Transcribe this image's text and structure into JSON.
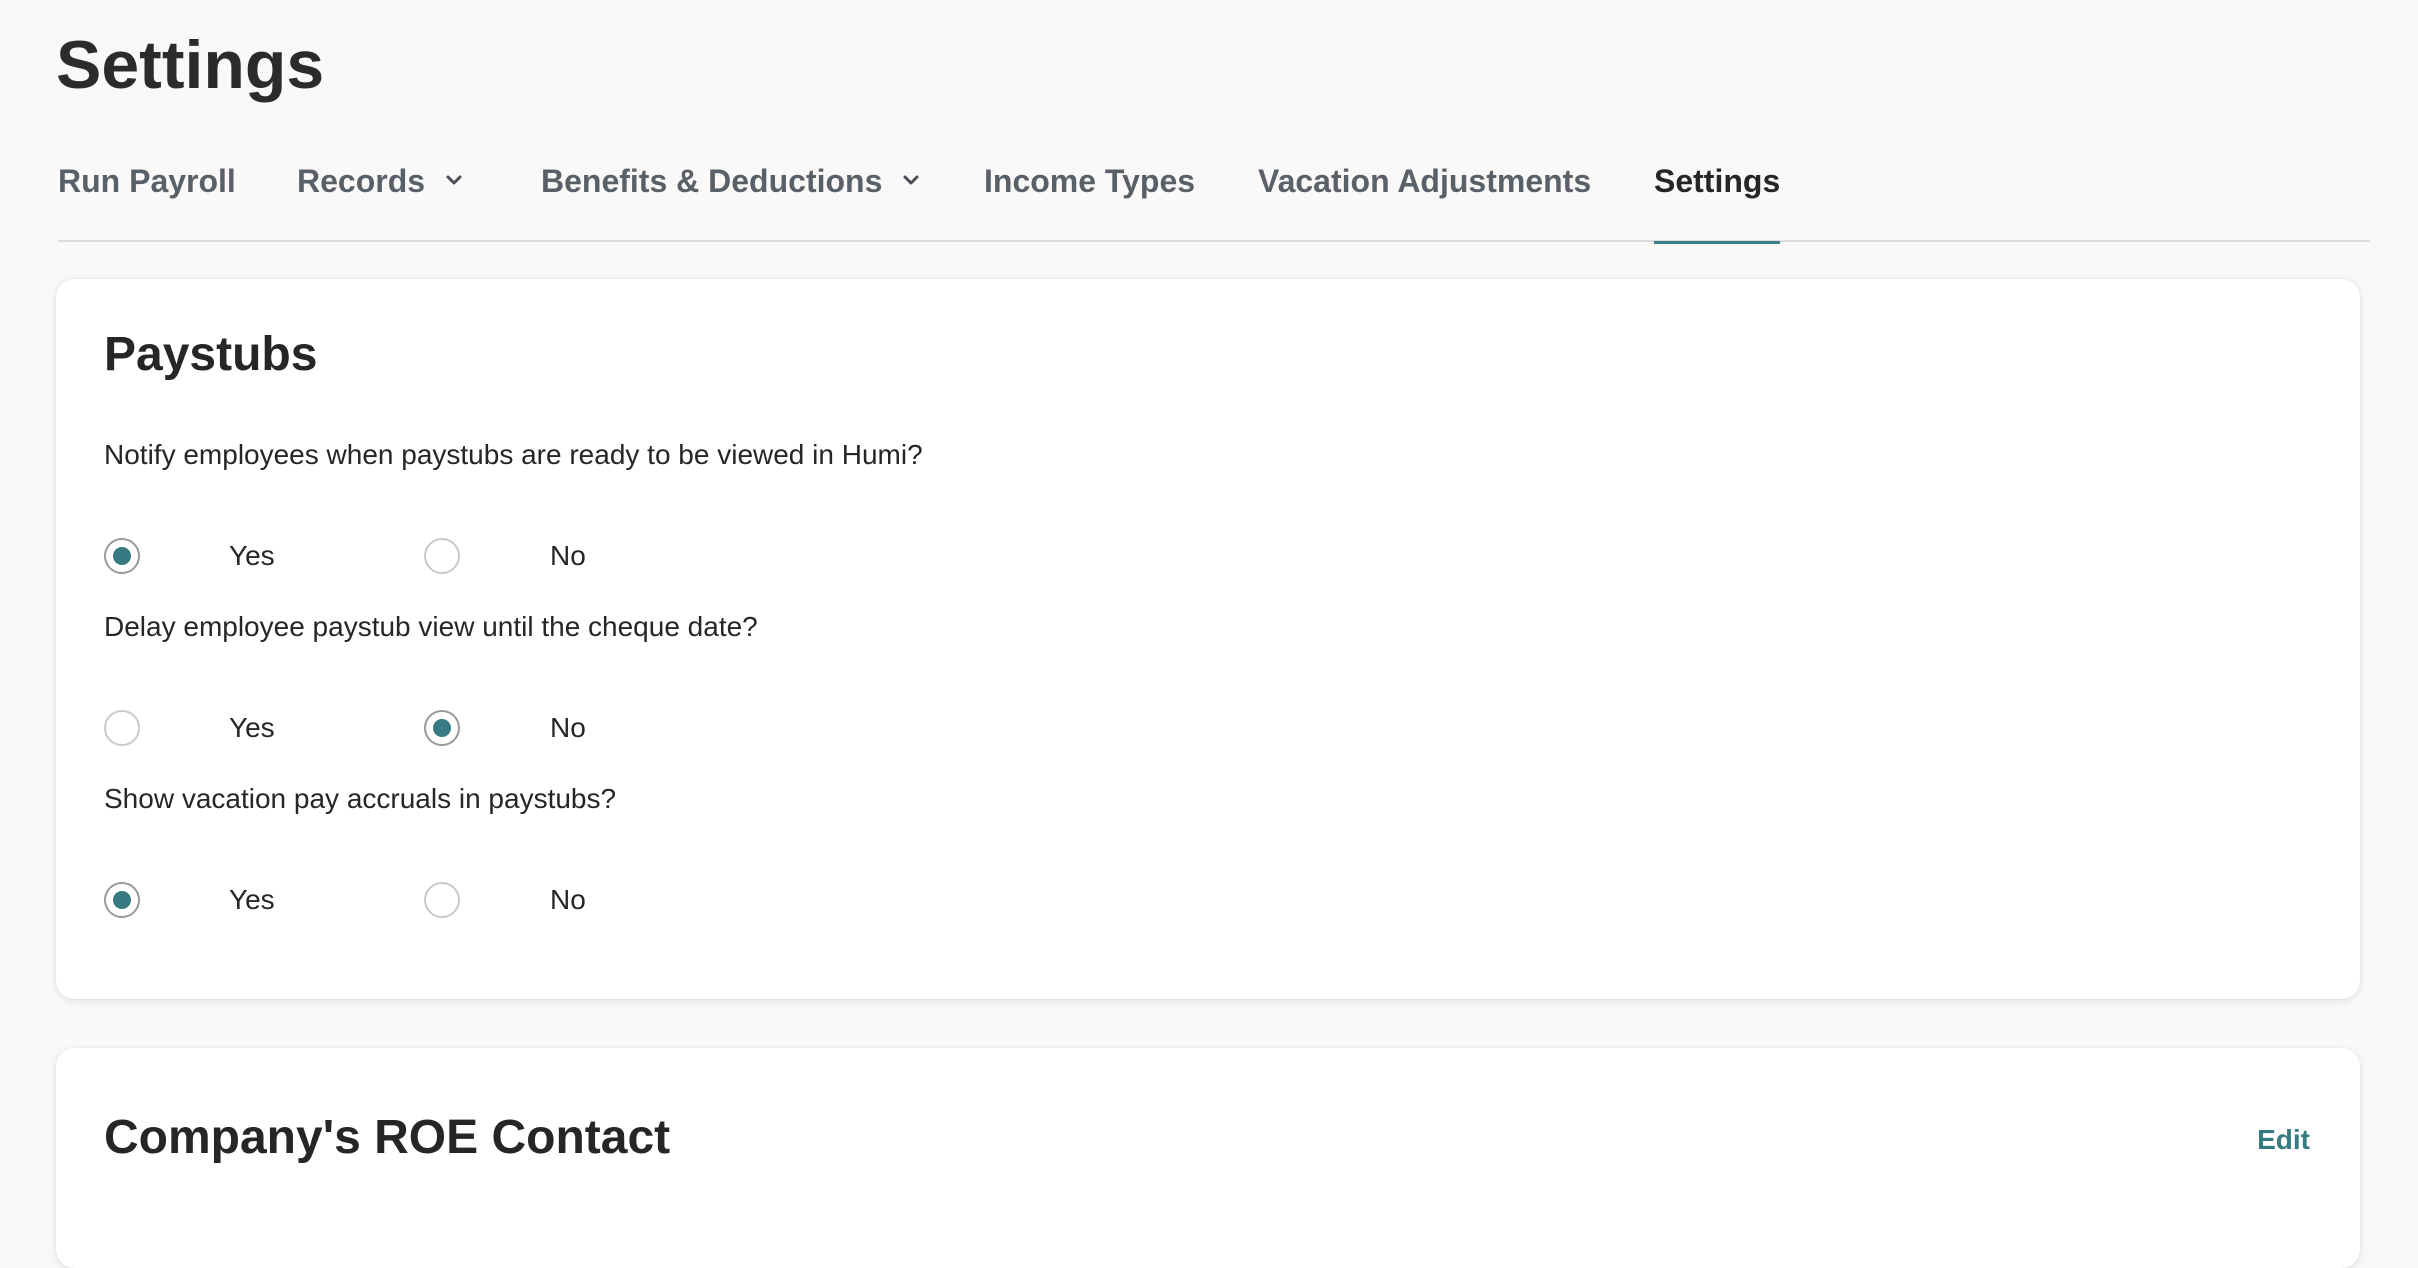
{
  "page": {
    "title": "Settings"
  },
  "tabs": [
    {
      "label": "Run Payroll",
      "has_dropdown": false,
      "active": false
    },
    {
      "label": "Records",
      "has_dropdown": true,
      "active": false
    },
    {
      "label": "Benefits & Deductions",
      "has_dropdown": true,
      "active": false
    },
    {
      "label": "Income Types",
      "has_dropdown": false,
      "active": false
    },
    {
      "label": "Vacation Adjustments",
      "has_dropdown": false,
      "active": false
    },
    {
      "label": "Settings",
      "has_dropdown": false,
      "active": true
    }
  ],
  "paystubs": {
    "title": "Paystubs",
    "questions": [
      {
        "text": "Notify employees when paystubs are ready to be viewed in Humi?",
        "options": [
          "Yes",
          "No"
        ],
        "selected": "Yes"
      },
      {
        "text": "Delay employee paystub view until the cheque date?",
        "options": [
          "Yes",
          "No"
        ],
        "selected": "No"
      },
      {
        "text": "Show vacation pay accruals in paystubs?",
        "options": [
          "Yes",
          "No"
        ],
        "selected": "Yes"
      }
    ]
  },
  "roe_contact": {
    "title": "Company's ROE Contact",
    "edit_label": "Edit"
  },
  "colors": {
    "accent": "#377b82",
    "background": "#faf9f7",
    "card": "#ffffff"
  }
}
